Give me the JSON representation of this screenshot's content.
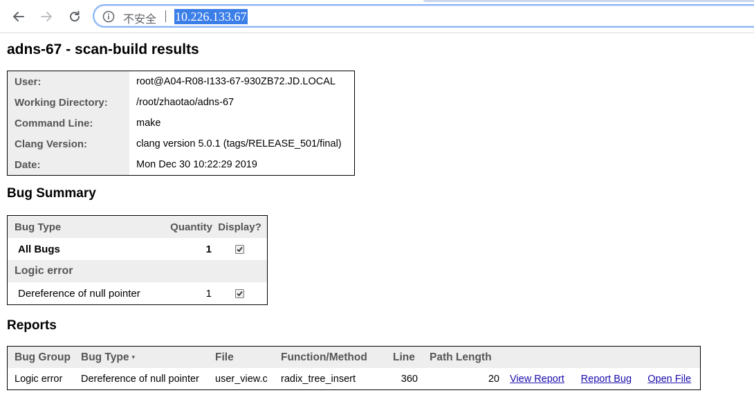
{
  "browser": {
    "insecure_label": "不安全",
    "url": "10.226.133.67"
  },
  "page": {
    "title": "adns-67 - scan-build results"
  },
  "info": {
    "rows": [
      {
        "label": "User:",
        "value": "root@A04-R08-I133-67-930ZB72.JD.LOCAL"
      },
      {
        "label": "Working Directory:",
        "value": "/root/zhaotao/adns-67"
      },
      {
        "label": "Command Line:",
        "value": "make"
      },
      {
        "label": "Clang Version:",
        "value": "clang version 5.0.1 (tags/RELEASE_501/final)"
      },
      {
        "label": "Date:",
        "value": "Mon Dec 30 10:22:29 2019"
      }
    ]
  },
  "summary": {
    "heading": "Bug Summary",
    "columns": [
      "Bug Type",
      "Quantity",
      "Display?"
    ],
    "all_bugs": {
      "label": "All Bugs",
      "quantity": "1",
      "checked": true
    },
    "group": "Logic error",
    "items": [
      {
        "label": "Dereference of null pointer",
        "quantity": "1",
        "checked": true
      }
    ]
  },
  "reports": {
    "heading": "Reports",
    "columns": [
      "Bug Group",
      "Bug Type",
      "File",
      "Function/Method",
      "Line",
      "Path Length"
    ],
    "sort_indicator": "▾",
    "rows": [
      {
        "bug_group": "Logic error",
        "bug_type": "Dereference of null pointer",
        "file": "user_view.c",
        "function": "radix_tree_insert",
        "line": "360",
        "path_length": "20",
        "view_report": "View Report",
        "report_bug": "Report Bug",
        "open_file": "Open File"
      }
    ]
  }
}
